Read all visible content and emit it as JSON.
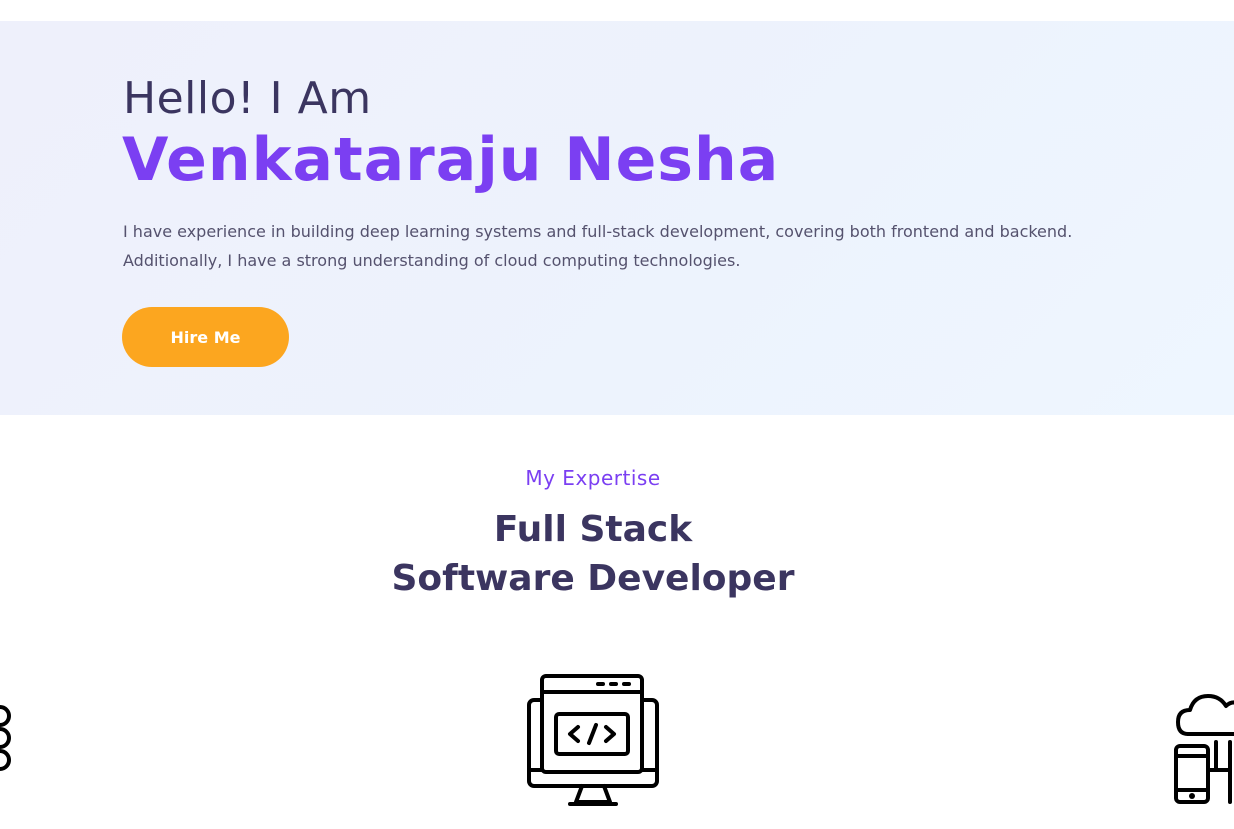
{
  "hero": {
    "greeting": "Hello! I Am",
    "name": "Venkataraju Nesha",
    "description": "I have experience in building deep learning systems and full-stack development, covering both frontend and backend. Additionally, I have a strong understanding of cloud computing technologies.",
    "cta_label": "Hire Me"
  },
  "expertise": {
    "label": "My Expertise",
    "title_line1": "Full Stack",
    "title_line2": "Software Developer",
    "cards": [
      {
        "icon": "link-chain-icon"
      },
      {
        "icon": "code-monitor-icon"
      },
      {
        "icon": "cloud-devices-icon"
      }
    ]
  },
  "colors": {
    "accent": "#7b3ff2",
    "heading": "#3b3560",
    "button": "#fca61f",
    "hero_bg": "#eef2fc"
  }
}
